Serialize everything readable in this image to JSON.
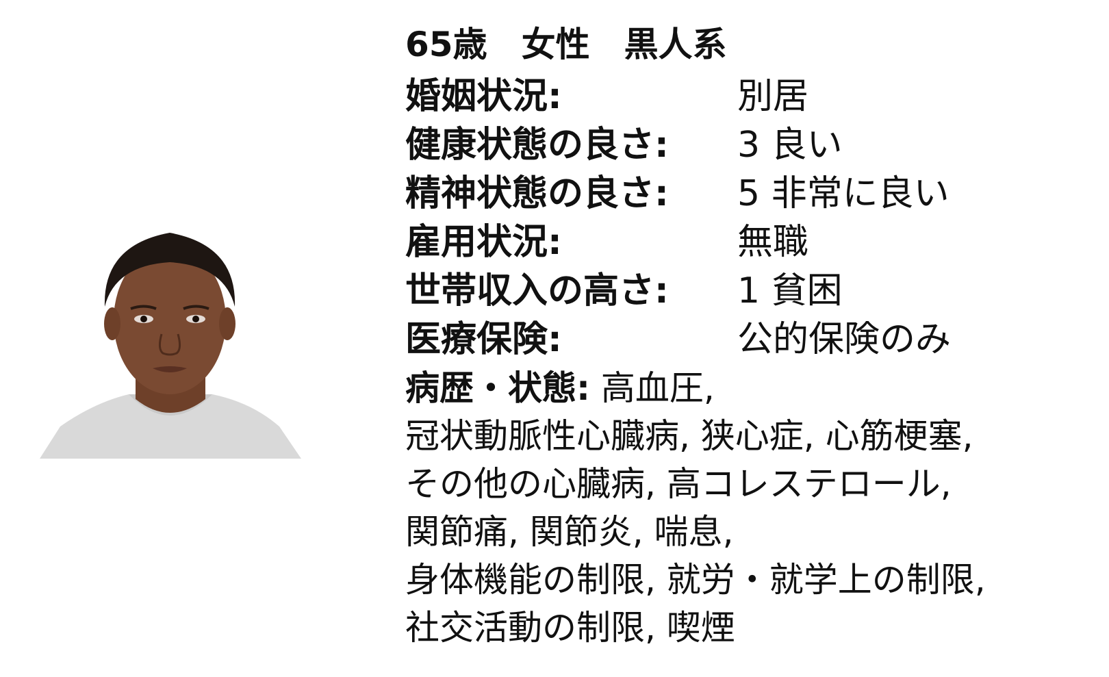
{
  "profile": {
    "headline": "65歳　女性　黒人系",
    "attributes": [
      {
        "label": "婚姻状況:",
        "value": "別居"
      },
      {
        "label": "健康状態の良さ:",
        "value": "3 良い"
      },
      {
        "label": "精神状態の良さ:",
        "value": "5 非常に良い"
      },
      {
        "label": "雇用状況:",
        "value": "無職"
      },
      {
        "label": "世帯収入の高さ:",
        "value": "1 貧困"
      },
      {
        "label": "医療保険:",
        "value": "公的保険のみ"
      }
    ],
    "history": {
      "label": "病歴・状態:",
      "text": " 高血圧,\n冠状動脈性心臓病, 狭心症, 心筋梗塞,\nその他の心臓病, 高コレステロール,\n関節痛, 関節炎, 喘息,\n身体機能の制限, 就労・就学上の制限,\n社交活動の制限, 喫煙"
    }
  },
  "colors": {
    "text": "#111111",
    "background": "#ffffff",
    "shirt": "#d8d8d8",
    "skin": "#7a4a32",
    "hair": "#1e1612"
  }
}
